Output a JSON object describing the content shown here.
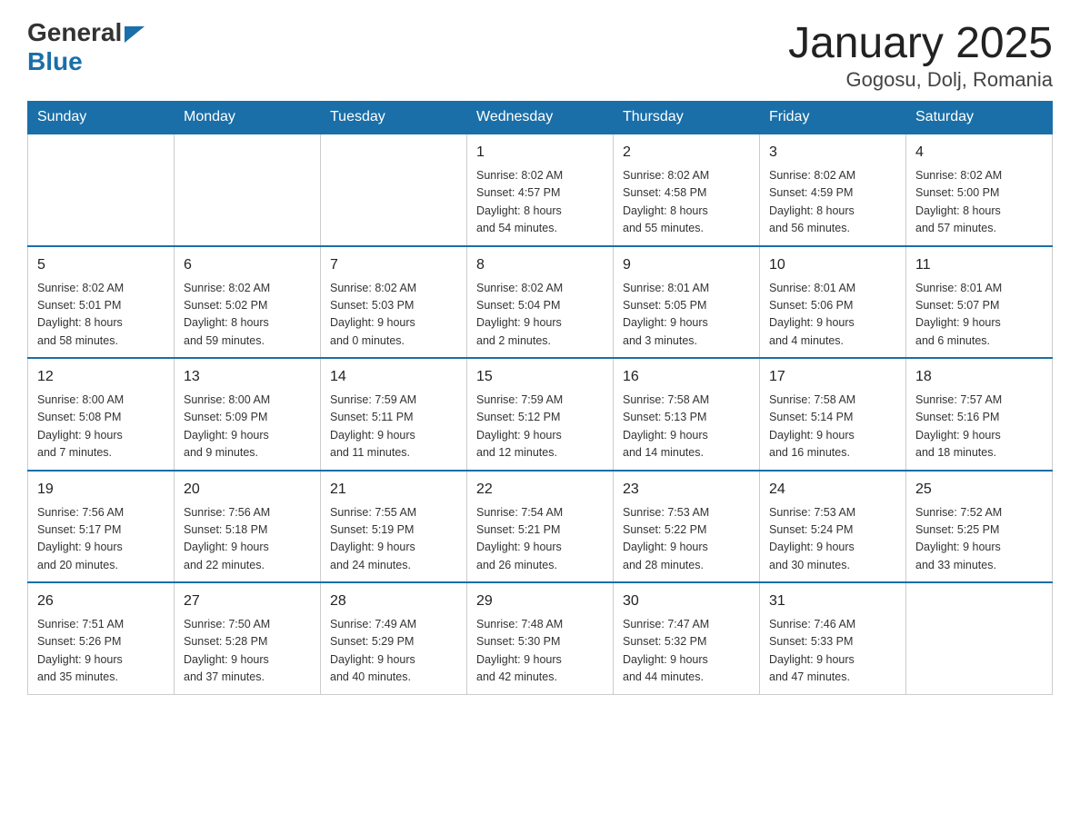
{
  "logo": {
    "general": "General",
    "blue": "Blue"
  },
  "title": "January 2025",
  "subtitle": "Gogosu, Dolj, Romania",
  "days_of_week": [
    "Sunday",
    "Monday",
    "Tuesday",
    "Wednesday",
    "Thursday",
    "Friday",
    "Saturday"
  ],
  "weeks": [
    [
      {
        "day": "",
        "info": ""
      },
      {
        "day": "",
        "info": ""
      },
      {
        "day": "",
        "info": ""
      },
      {
        "day": "1",
        "info": "Sunrise: 8:02 AM\nSunset: 4:57 PM\nDaylight: 8 hours\nand 54 minutes."
      },
      {
        "day": "2",
        "info": "Sunrise: 8:02 AM\nSunset: 4:58 PM\nDaylight: 8 hours\nand 55 minutes."
      },
      {
        "day": "3",
        "info": "Sunrise: 8:02 AM\nSunset: 4:59 PM\nDaylight: 8 hours\nand 56 minutes."
      },
      {
        "day": "4",
        "info": "Sunrise: 8:02 AM\nSunset: 5:00 PM\nDaylight: 8 hours\nand 57 minutes."
      }
    ],
    [
      {
        "day": "5",
        "info": "Sunrise: 8:02 AM\nSunset: 5:01 PM\nDaylight: 8 hours\nand 58 minutes."
      },
      {
        "day": "6",
        "info": "Sunrise: 8:02 AM\nSunset: 5:02 PM\nDaylight: 8 hours\nand 59 minutes."
      },
      {
        "day": "7",
        "info": "Sunrise: 8:02 AM\nSunset: 5:03 PM\nDaylight: 9 hours\nand 0 minutes."
      },
      {
        "day": "8",
        "info": "Sunrise: 8:02 AM\nSunset: 5:04 PM\nDaylight: 9 hours\nand 2 minutes."
      },
      {
        "day": "9",
        "info": "Sunrise: 8:01 AM\nSunset: 5:05 PM\nDaylight: 9 hours\nand 3 minutes."
      },
      {
        "day": "10",
        "info": "Sunrise: 8:01 AM\nSunset: 5:06 PM\nDaylight: 9 hours\nand 4 minutes."
      },
      {
        "day": "11",
        "info": "Sunrise: 8:01 AM\nSunset: 5:07 PM\nDaylight: 9 hours\nand 6 minutes."
      }
    ],
    [
      {
        "day": "12",
        "info": "Sunrise: 8:00 AM\nSunset: 5:08 PM\nDaylight: 9 hours\nand 7 minutes."
      },
      {
        "day": "13",
        "info": "Sunrise: 8:00 AM\nSunset: 5:09 PM\nDaylight: 9 hours\nand 9 minutes."
      },
      {
        "day": "14",
        "info": "Sunrise: 7:59 AM\nSunset: 5:11 PM\nDaylight: 9 hours\nand 11 minutes."
      },
      {
        "day": "15",
        "info": "Sunrise: 7:59 AM\nSunset: 5:12 PM\nDaylight: 9 hours\nand 12 minutes."
      },
      {
        "day": "16",
        "info": "Sunrise: 7:58 AM\nSunset: 5:13 PM\nDaylight: 9 hours\nand 14 minutes."
      },
      {
        "day": "17",
        "info": "Sunrise: 7:58 AM\nSunset: 5:14 PM\nDaylight: 9 hours\nand 16 minutes."
      },
      {
        "day": "18",
        "info": "Sunrise: 7:57 AM\nSunset: 5:16 PM\nDaylight: 9 hours\nand 18 minutes."
      }
    ],
    [
      {
        "day": "19",
        "info": "Sunrise: 7:56 AM\nSunset: 5:17 PM\nDaylight: 9 hours\nand 20 minutes."
      },
      {
        "day": "20",
        "info": "Sunrise: 7:56 AM\nSunset: 5:18 PM\nDaylight: 9 hours\nand 22 minutes."
      },
      {
        "day": "21",
        "info": "Sunrise: 7:55 AM\nSunset: 5:19 PM\nDaylight: 9 hours\nand 24 minutes."
      },
      {
        "day": "22",
        "info": "Sunrise: 7:54 AM\nSunset: 5:21 PM\nDaylight: 9 hours\nand 26 minutes."
      },
      {
        "day": "23",
        "info": "Sunrise: 7:53 AM\nSunset: 5:22 PM\nDaylight: 9 hours\nand 28 minutes."
      },
      {
        "day": "24",
        "info": "Sunrise: 7:53 AM\nSunset: 5:24 PM\nDaylight: 9 hours\nand 30 minutes."
      },
      {
        "day": "25",
        "info": "Sunrise: 7:52 AM\nSunset: 5:25 PM\nDaylight: 9 hours\nand 33 minutes."
      }
    ],
    [
      {
        "day": "26",
        "info": "Sunrise: 7:51 AM\nSunset: 5:26 PM\nDaylight: 9 hours\nand 35 minutes."
      },
      {
        "day": "27",
        "info": "Sunrise: 7:50 AM\nSunset: 5:28 PM\nDaylight: 9 hours\nand 37 minutes."
      },
      {
        "day": "28",
        "info": "Sunrise: 7:49 AM\nSunset: 5:29 PM\nDaylight: 9 hours\nand 40 minutes."
      },
      {
        "day": "29",
        "info": "Sunrise: 7:48 AM\nSunset: 5:30 PM\nDaylight: 9 hours\nand 42 minutes."
      },
      {
        "day": "30",
        "info": "Sunrise: 7:47 AM\nSunset: 5:32 PM\nDaylight: 9 hours\nand 44 minutes."
      },
      {
        "day": "31",
        "info": "Sunrise: 7:46 AM\nSunset: 5:33 PM\nDaylight: 9 hours\nand 47 minutes."
      },
      {
        "day": "",
        "info": ""
      }
    ]
  ]
}
